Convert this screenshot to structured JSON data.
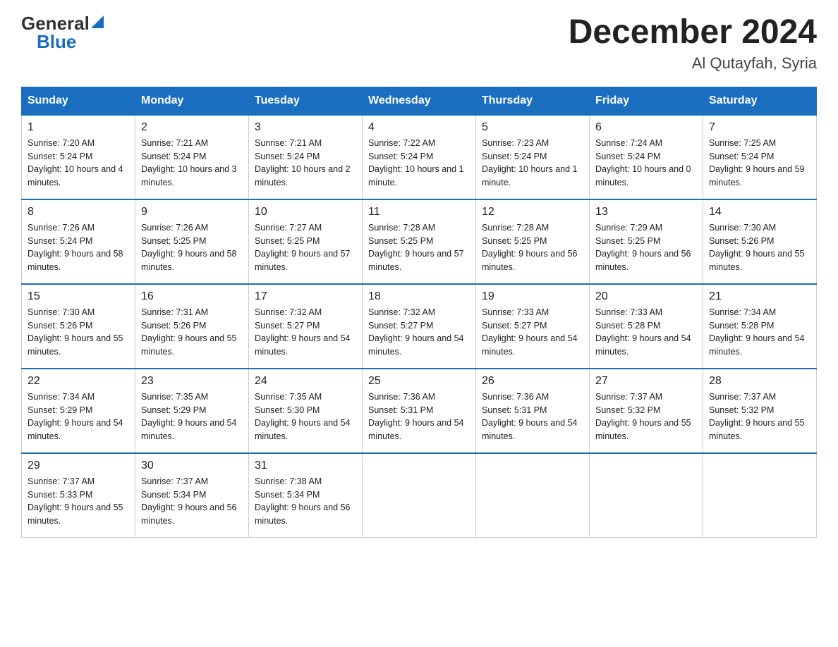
{
  "header": {
    "logo_general": "General",
    "logo_blue": "Blue",
    "main_title": "December 2024",
    "subtitle": "Al Qutayfah, Syria"
  },
  "days_of_week": [
    "Sunday",
    "Monday",
    "Tuesday",
    "Wednesday",
    "Thursday",
    "Friday",
    "Saturday"
  ],
  "weeks": [
    [
      {
        "day": "1",
        "sunrise": "7:20 AM",
        "sunset": "5:24 PM",
        "daylight": "10 hours and 4 minutes."
      },
      {
        "day": "2",
        "sunrise": "7:21 AM",
        "sunset": "5:24 PM",
        "daylight": "10 hours and 3 minutes."
      },
      {
        "day": "3",
        "sunrise": "7:21 AM",
        "sunset": "5:24 PM",
        "daylight": "10 hours and 2 minutes."
      },
      {
        "day": "4",
        "sunrise": "7:22 AM",
        "sunset": "5:24 PM",
        "daylight": "10 hours and 1 minute."
      },
      {
        "day": "5",
        "sunrise": "7:23 AM",
        "sunset": "5:24 PM",
        "daylight": "10 hours and 1 minute."
      },
      {
        "day": "6",
        "sunrise": "7:24 AM",
        "sunset": "5:24 PM",
        "daylight": "10 hours and 0 minutes."
      },
      {
        "day": "7",
        "sunrise": "7:25 AM",
        "sunset": "5:24 PM",
        "daylight": "9 hours and 59 minutes."
      }
    ],
    [
      {
        "day": "8",
        "sunrise": "7:26 AM",
        "sunset": "5:24 PM",
        "daylight": "9 hours and 58 minutes."
      },
      {
        "day": "9",
        "sunrise": "7:26 AM",
        "sunset": "5:25 PM",
        "daylight": "9 hours and 58 minutes."
      },
      {
        "day": "10",
        "sunrise": "7:27 AM",
        "sunset": "5:25 PM",
        "daylight": "9 hours and 57 minutes."
      },
      {
        "day": "11",
        "sunrise": "7:28 AM",
        "sunset": "5:25 PM",
        "daylight": "9 hours and 57 minutes."
      },
      {
        "day": "12",
        "sunrise": "7:28 AM",
        "sunset": "5:25 PM",
        "daylight": "9 hours and 56 minutes."
      },
      {
        "day": "13",
        "sunrise": "7:29 AM",
        "sunset": "5:25 PM",
        "daylight": "9 hours and 56 minutes."
      },
      {
        "day": "14",
        "sunrise": "7:30 AM",
        "sunset": "5:26 PM",
        "daylight": "9 hours and 55 minutes."
      }
    ],
    [
      {
        "day": "15",
        "sunrise": "7:30 AM",
        "sunset": "5:26 PM",
        "daylight": "9 hours and 55 minutes."
      },
      {
        "day": "16",
        "sunrise": "7:31 AM",
        "sunset": "5:26 PM",
        "daylight": "9 hours and 55 minutes."
      },
      {
        "day": "17",
        "sunrise": "7:32 AM",
        "sunset": "5:27 PM",
        "daylight": "9 hours and 54 minutes."
      },
      {
        "day": "18",
        "sunrise": "7:32 AM",
        "sunset": "5:27 PM",
        "daylight": "9 hours and 54 minutes."
      },
      {
        "day": "19",
        "sunrise": "7:33 AM",
        "sunset": "5:27 PM",
        "daylight": "9 hours and 54 minutes."
      },
      {
        "day": "20",
        "sunrise": "7:33 AM",
        "sunset": "5:28 PM",
        "daylight": "9 hours and 54 minutes."
      },
      {
        "day": "21",
        "sunrise": "7:34 AM",
        "sunset": "5:28 PM",
        "daylight": "9 hours and 54 minutes."
      }
    ],
    [
      {
        "day": "22",
        "sunrise": "7:34 AM",
        "sunset": "5:29 PM",
        "daylight": "9 hours and 54 minutes."
      },
      {
        "day": "23",
        "sunrise": "7:35 AM",
        "sunset": "5:29 PM",
        "daylight": "9 hours and 54 minutes."
      },
      {
        "day": "24",
        "sunrise": "7:35 AM",
        "sunset": "5:30 PM",
        "daylight": "9 hours and 54 minutes."
      },
      {
        "day": "25",
        "sunrise": "7:36 AM",
        "sunset": "5:31 PM",
        "daylight": "9 hours and 54 minutes."
      },
      {
        "day": "26",
        "sunrise": "7:36 AM",
        "sunset": "5:31 PM",
        "daylight": "9 hours and 54 minutes."
      },
      {
        "day": "27",
        "sunrise": "7:37 AM",
        "sunset": "5:32 PM",
        "daylight": "9 hours and 55 minutes."
      },
      {
        "day": "28",
        "sunrise": "7:37 AM",
        "sunset": "5:32 PM",
        "daylight": "9 hours and 55 minutes."
      }
    ],
    [
      {
        "day": "29",
        "sunrise": "7:37 AM",
        "sunset": "5:33 PM",
        "daylight": "9 hours and 55 minutes."
      },
      {
        "day": "30",
        "sunrise": "7:37 AM",
        "sunset": "5:34 PM",
        "daylight": "9 hours and 56 minutes."
      },
      {
        "day": "31",
        "sunrise": "7:38 AM",
        "sunset": "5:34 PM",
        "daylight": "9 hours and 56 minutes."
      },
      null,
      null,
      null,
      null
    ]
  ]
}
